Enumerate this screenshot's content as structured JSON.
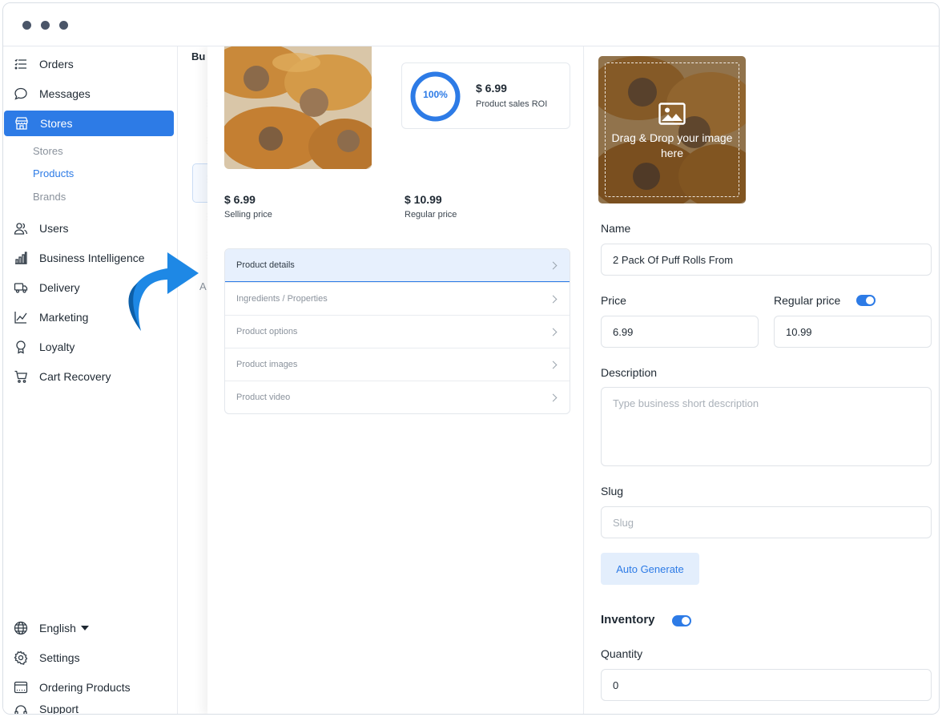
{
  "window": {
    "controls": [
      "close",
      "minimize",
      "maximize"
    ]
  },
  "sidebar": {
    "items": [
      {
        "label": "Orders",
        "icon": "list-icon"
      },
      {
        "label": "Messages",
        "icon": "chat-bubble-icon"
      },
      {
        "label": "Stores",
        "icon": "store-icon",
        "active": true
      },
      {
        "label": "Users",
        "icon": "users-icon"
      },
      {
        "label": "Business Intelligence",
        "icon": "bar-chart-icon"
      },
      {
        "label": "Delivery",
        "icon": "truck-icon"
      },
      {
        "label": "Marketing",
        "icon": "line-chart-icon"
      },
      {
        "label": "Loyalty",
        "icon": "award-icon"
      },
      {
        "label": "Cart Recovery",
        "icon": "cart-icon"
      }
    ],
    "subitems": [
      {
        "label": "Stores"
      },
      {
        "label": "Products",
        "active": true
      },
      {
        "label": "Brands"
      }
    ],
    "bottom": [
      {
        "label": "English",
        "icon": "globe-icon"
      },
      {
        "label": "Settings",
        "icon": "gear-icon"
      },
      {
        "label": "Ordering Products",
        "icon": "window-icon"
      },
      {
        "label": "Support",
        "icon": "headset-icon"
      }
    ]
  },
  "background_list": {
    "header": "Bu",
    "letter": "A"
  },
  "product": {
    "roi_percent": "100%",
    "roi_value": 100,
    "roi_price": "$ 6.99",
    "roi_label": "Product sales ROI",
    "selling_price": "$ 6.99",
    "selling_label": "Selling price",
    "regular_price": "$ 10.99",
    "regular_label": "Regular price",
    "sections": [
      "Product details",
      "Ingredients / Properties",
      "Product options",
      "Product images",
      "Product video"
    ]
  },
  "form": {
    "upload_text": "Drag & Drop your image here",
    "name_label": "Name",
    "name_value": "2 Pack Of Puff Rolls From",
    "price_label": "Price",
    "price_value": "6.99",
    "regular_price_label": "Regular price",
    "regular_price_value": "10.99",
    "regular_price_enabled": true,
    "description_label": "Description",
    "description_placeholder": "Type business short description",
    "slug_label": "Slug",
    "slug_placeholder": "Slug",
    "auto_generate": "Auto Generate",
    "inventory_label": "Inventory",
    "inventory_enabled": true,
    "quantity_label": "Quantity",
    "quantity_value": "0"
  },
  "colors": {
    "accent": "#2d7be6",
    "accent_light": "#e3eefc",
    "arrow": "#1e88e5"
  }
}
